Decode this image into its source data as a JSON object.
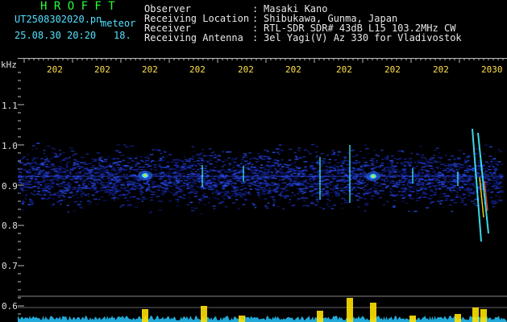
{
  "title_left": {
    "software": "H R O F F T",
    "filename_a": "UT2508302020.pn",
    "filename_b": "meteor",
    "datetime": "25.08.30 20:20",
    "count": "18."
  },
  "header_fields": [
    {
      "label": "Observer",
      "value": "Masaki Kano"
    },
    {
      "label": "Receiving Location",
      "value": "Shibukawa, Gunma, Japan"
    },
    {
      "label": "Receiver",
      "value": "RTL-SDR SDR# 43dB L15 103.2MHz CW"
    },
    {
      "label": "Receiving Antenna",
      "value": "3el Yagi(V) Az 330 for Vladivostok"
    }
  ],
  "separator": ":",
  "y_axis": {
    "unit": "kHz",
    "ticks": [
      "1.1",
      "1.0",
      "0.9",
      "0.8",
      "0.7",
      "0.6"
    ]
  },
  "x_axis": {
    "ticks": [
      "202",
      "202",
      "202",
      "202",
      "202",
      "202",
      "202",
      "202",
      "202",
      "2030"
    ]
  },
  "colors": {
    "header_text": "#e8e8e8",
    "title_cyan": "#53e0ff",
    "software_green": "#27ff35",
    "tick_yellow": "#ffe14a",
    "noise_band": "#1a2db0",
    "echo_cyan": "#40f0ff",
    "echo_yellow": "#ffe000",
    "strip_cyan": "#27c8ff"
  }
}
